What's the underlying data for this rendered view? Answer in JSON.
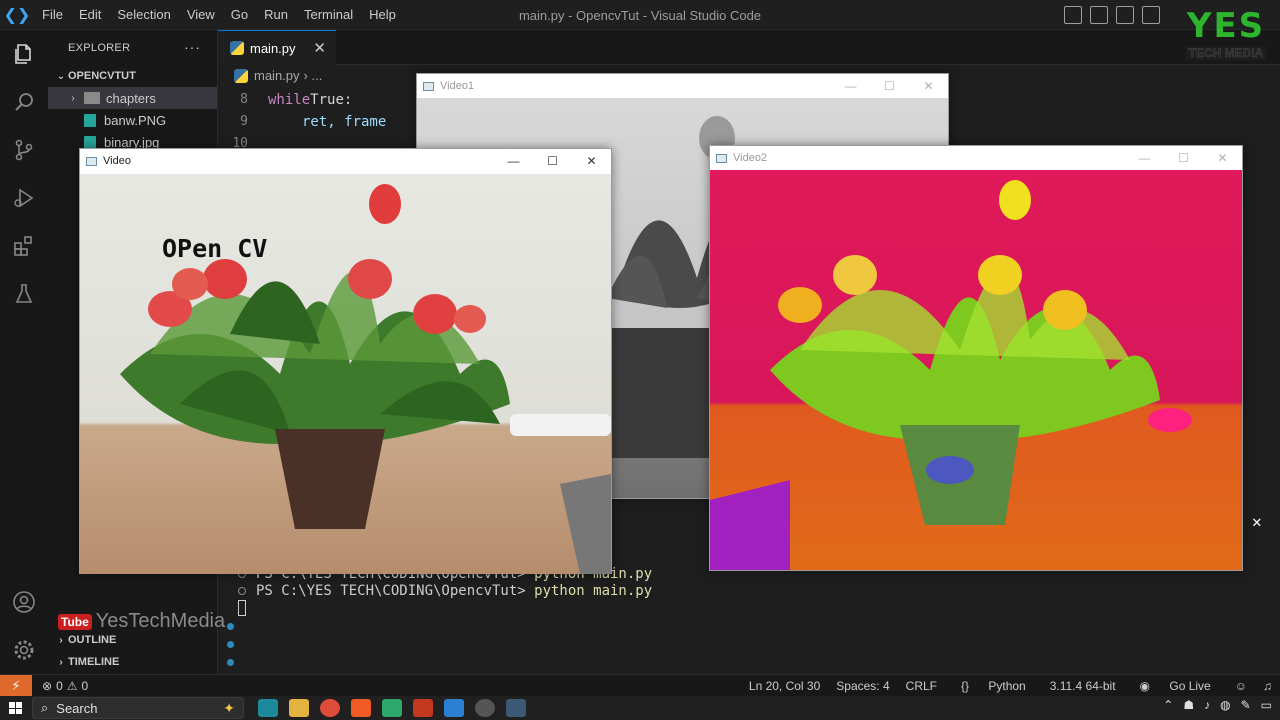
{
  "titlebar": {
    "menu": [
      "File",
      "Edit",
      "Selection",
      "View",
      "Go",
      "Run",
      "Terminal",
      "Help"
    ],
    "window_title": "main.py - OpencvTut - Visual Studio Code"
  },
  "brand": {
    "logo_big": "YES",
    "logo_small": "TECH MEDIA",
    "watermark_badge": "Tube",
    "watermark_text": "YesTechMedia"
  },
  "sidebar": {
    "header": "EXPLORER",
    "dots": "···",
    "project": "OPENCVTUT",
    "items": [
      {
        "label": "chapters",
        "kind": "folder"
      },
      {
        "label": "banw.PNG",
        "kind": "image"
      },
      {
        "label": "binary.jpg",
        "kind": "image"
      }
    ],
    "outline": "OUTLINE",
    "timeline": "TIMELINE"
  },
  "editor": {
    "tab_label": "main.py",
    "breadcrumb_file": "main.py",
    "breadcrumb_rest": "› ...",
    "lines": [
      {
        "num": "8",
        "kw": "while",
        "rest": " True:"
      },
      {
        "num": "9",
        "text": "ret, frame"
      },
      {
        "num": "10",
        "text": ""
      }
    ]
  },
  "windows": {
    "video": {
      "title": "Video",
      "overlay_text": "OPen CV"
    },
    "video1": {
      "title": "Video1"
    },
    "video2": {
      "title": "Video2"
    },
    "controls": {
      "min": "—",
      "max": "☐",
      "close": "✕"
    }
  },
  "terminal": {
    "line1_prompt": "PS C:\\YES TECH\\CODING\\OpencvTut>",
    "line1_cmd": " python main.py",
    "line2_prompt": "PS C:\\YES TECH\\CODING\\OpencvTut>",
    "line2_cmd": " python main.py",
    "close": "✕"
  },
  "statusbar": {
    "errors": "0",
    "warnings": "0",
    "position": "Ln 20, Col 30",
    "spaces": "Spaces: 4",
    "eol": "CRLF",
    "language": "Python",
    "interpreter": "3.11.4 64-bit",
    "golive": "Go Live"
  },
  "taskbar": {
    "search_placeholder": "Search"
  },
  "colors": {
    "accent": "#0078d4",
    "remote": "#e0692c",
    "brand_green": "#2db52d"
  }
}
